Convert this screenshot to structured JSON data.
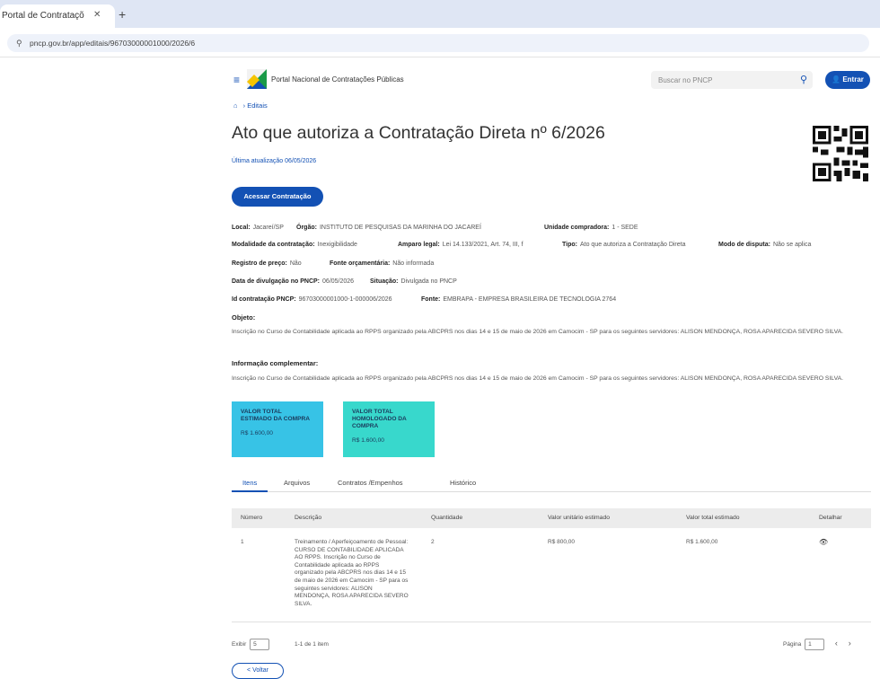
{
  "browser": {
    "tab_title": "Portal de Contrataçõ",
    "tab_close": "✕",
    "new_tab": "+",
    "url": "pncp.gov.br/app/editais/96703000001000/2026/6"
  },
  "header": {
    "portal_name": "Portal Nacional de Contratações Públicas",
    "search_placeholder": "Buscar no PNCP",
    "enter_label": "Entrar"
  },
  "breadcrumb": {
    "current": "Editais"
  },
  "page": {
    "title": "Ato que autoriza a Contratação Direta nº 6/2026",
    "subtitle": "Última atualização 06/05/2026",
    "access_button": "Acessar Contratação"
  },
  "fields": {
    "local_label": "Local:",
    "local_value": "Jacareí/SP",
    "orgao_label": "Órgão:",
    "orgao_value": "INSTITUTO DE PESQUISAS DA MARINHA DO JACAREÍ",
    "unidade_label": "Unidade compradora:",
    "unidade_value": "1 - SEDE",
    "modalidade_label": "Modalidade da contratação:",
    "modalidade_value": "Inexigibilidade",
    "amparo_label": "Amparo legal:",
    "amparo_value": "Lei 14.133/2021, Art. 74, III, f",
    "tipo_label": "Tipo:",
    "tipo_value": "Ato que autoriza a Contratação Direta",
    "disputa_label": "Modo de disputa:",
    "disputa_value": "Não se aplica",
    "registro_label": "Registro de preço:",
    "registro_value": "Não",
    "fonte_label": "Fonte orçamentária:",
    "fonte_value": "Não informada",
    "divulgacao_label": "Data de divulgação no PNCP:",
    "divulgacao_value": "06/05/2026",
    "situacao_label": "Situação:",
    "situacao_value": "Divulgada no PNCP",
    "idpncp_label": "Id contratação PNCP:",
    "idpncp_value": "96703000001000-1-000006/2026",
    "fonteid_label": "Fonte:",
    "fonteid_value": "EMBRAPA - EMPRESA BRASILEIRA DE TECNOLOGIA 2764"
  },
  "objeto": {
    "title": "Objeto:",
    "text": "Inscrição no Curso de Contabilidade aplicada ao RPPS organizado pela ABCPRS nos dias 14 e 15 de maio de 2026 em Camocim - SP para os seguintes servidores: ALISON MENDONÇA, ROSA APARECIDA SEVERO SILVA."
  },
  "info": {
    "title": "Informação complementar:",
    "text": "Inscrição no Curso de Contabilidade aplicada ao RPPS organizado pela ABCPRS nos dias 14 e 15 de maio de 2026 em Camocim - SP para os seguintes servidores: ALISON MENDONÇA, ROSA APARECIDA SEVERO SILVA."
  },
  "cards": [
    {
      "label": "VALOR TOTAL ESTIMADO DA COMPRA",
      "value": "R$ 1.600,00"
    },
    {
      "label": "VALOR TOTAL HOMOLOGADO DA COMPRA",
      "value": "R$ 1.600,00"
    }
  ],
  "tabs": [
    "Itens",
    "Arquivos",
    "Contratos /Empenhos",
    "Histórico"
  ],
  "table": {
    "headers": [
      "Número",
      "Descrição",
      "Quantidade",
      "Valor unitário estimado",
      "Valor total estimado",
      "Detalhar"
    ],
    "row": {
      "numero": "1",
      "descricao": "Treinamento / Aperfeiçoamento de Pessoal: CURSO DE CONTABILIDADE APLICADA AO RPPS. Inscrição no Curso de Contabilidade aplicada ao RPPS organizado pela ABCPRS nos dias 14 e 15 de maio de 2026 em Camocim - SP para os seguintes servidores: ALISON MENDONÇA, ROSA APARECIDA SEVERO SILVA.",
      "quantidade": "2",
      "unitario": "R$ 800,00",
      "total": "R$ 1.600,00"
    }
  },
  "pager": {
    "show_label": "Exibir",
    "show_value": "5",
    "items_label": "1-1 de 1 item",
    "page_label": "Página",
    "page_value": "1",
    "prev": "‹",
    "next": "›"
  },
  "back_label": "< Voltar"
}
